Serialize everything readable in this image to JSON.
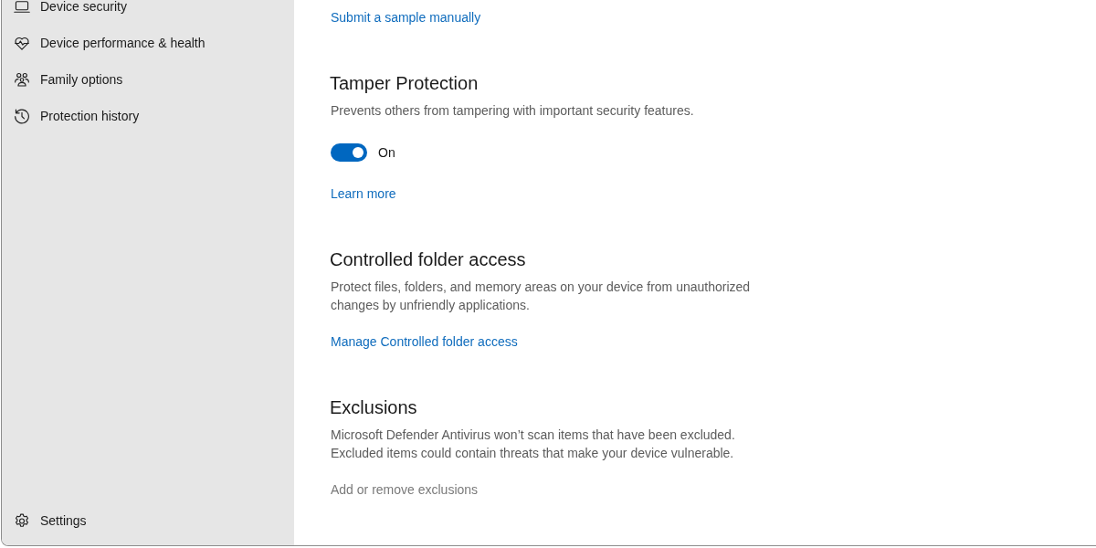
{
  "sidebar": {
    "items": [
      {
        "label": "Device security",
        "selected": false
      },
      {
        "label": "Device performance & health",
        "selected": false
      },
      {
        "label": "Family options",
        "selected": false
      },
      {
        "label": "Protection history",
        "selected": false
      }
    ],
    "footer": {
      "label": "Settings"
    }
  },
  "content": {
    "top_link": {
      "text": "Submit a sample manually"
    },
    "sections": [
      {
        "title": "Tamper Protection",
        "description": "Prevents others from tampering with important security features.",
        "toggle": {
          "on": true,
          "label": "On"
        },
        "link": {
          "text": "Learn more",
          "disabled": false
        }
      },
      {
        "title": "Controlled folder access",
        "description": "Protect files, folders, and memory areas on your device from unauthorized changes by unfriendly applications.",
        "link": {
          "text": "Manage Controlled folder access",
          "disabled": false
        }
      },
      {
        "title": "Exclusions",
        "description": "Microsoft Defender Antivirus won’t scan items that have been excluded. Excluded items could contain threats that make your device vulnerable.",
        "link": {
          "text": "Add or remove exclusions",
          "disabled": true
        }
      }
    ]
  }
}
